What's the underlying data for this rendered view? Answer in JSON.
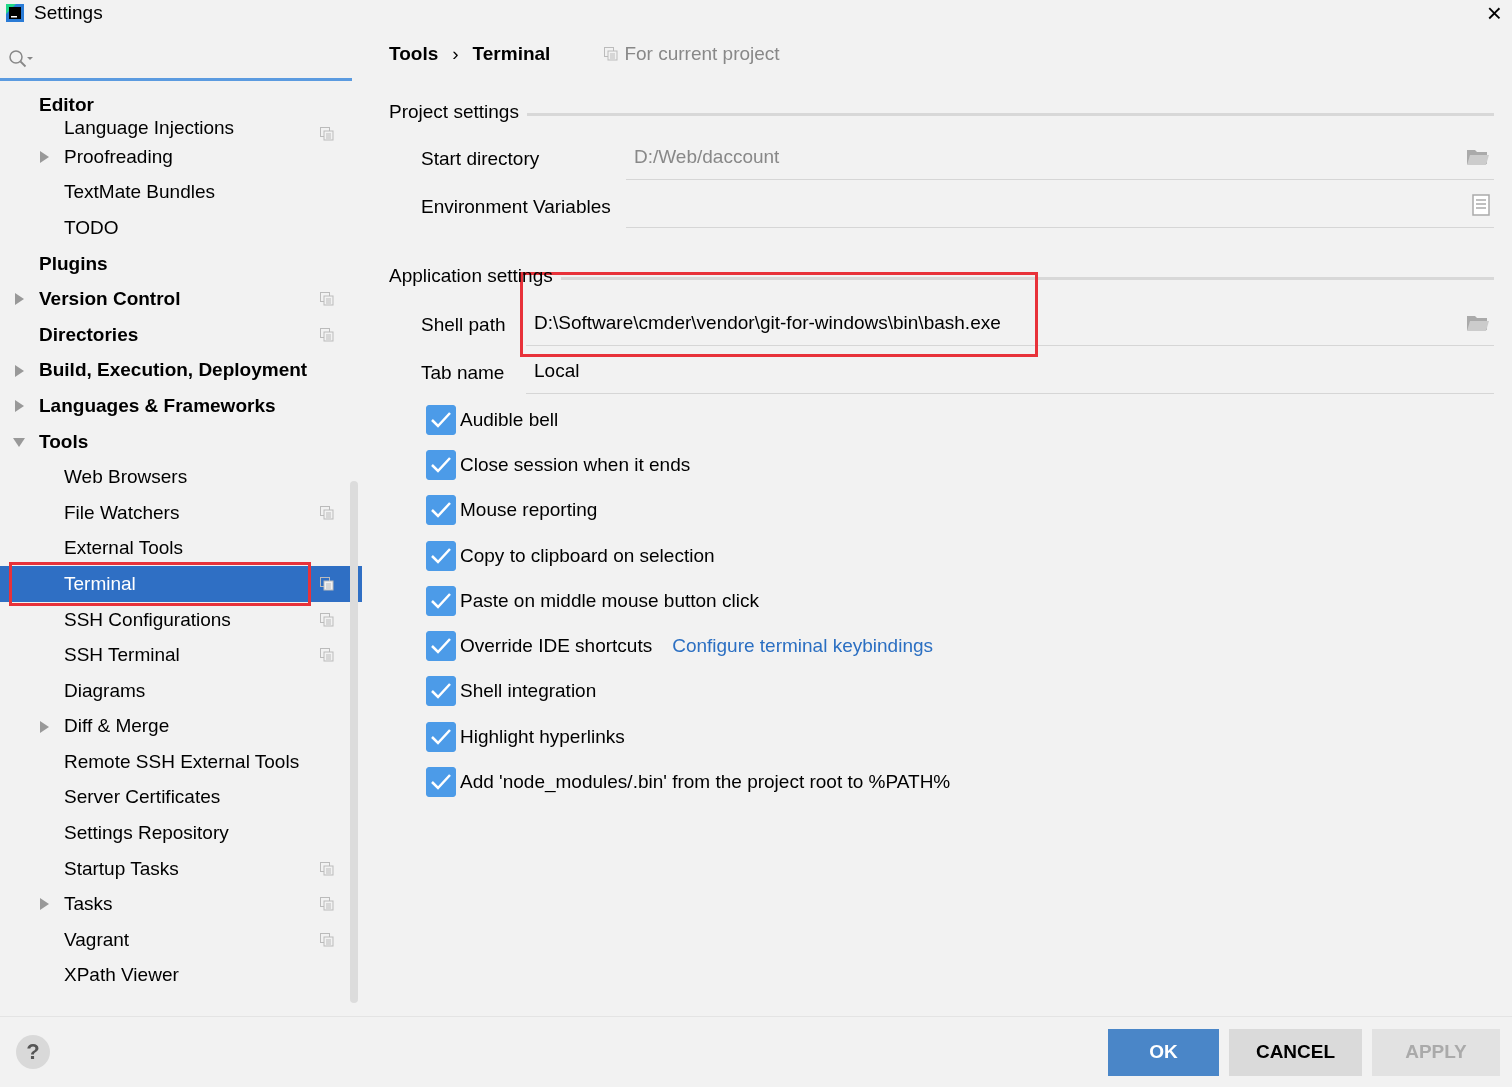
{
  "window": {
    "title": "Settings",
    "close": "×"
  },
  "sidebar": {
    "items": [
      {
        "label": "Editor",
        "bold": true,
        "scoped": false,
        "selected": false,
        "highlighted": false,
        "children": [
          {
            "label": "Language Injections",
            "bold": false,
            "scoped": true,
            "selected": false,
            "highlighted": false
          },
          {
            "label": "Proofreading",
            "bold": false,
            "expanded": false,
            "scoped": false,
            "selected": false,
            "highlighted": false
          },
          {
            "label": "TextMate Bundles",
            "bold": false,
            "scoped": false,
            "selected": false,
            "highlighted": false
          },
          {
            "label": "TODO",
            "bold": false,
            "scoped": false,
            "selected": false,
            "highlighted": false
          }
        ]
      },
      {
        "label": "Plugins",
        "bold": true,
        "scoped": false,
        "selected": false,
        "highlighted": false
      },
      {
        "label": "Version Control",
        "bold": true,
        "expanded": false,
        "scoped": true,
        "selected": false,
        "highlighted": false
      },
      {
        "label": "Directories",
        "bold": true,
        "scoped": true,
        "selected": false,
        "highlighted": false
      },
      {
        "label": "Build, Execution, Deployment",
        "bold": true,
        "expanded": false,
        "scoped": false,
        "selected": false,
        "highlighted": false
      },
      {
        "label": "Languages & Frameworks",
        "bold": true,
        "expanded": false,
        "scoped": false,
        "selected": false,
        "highlighted": false
      },
      {
        "label": "Tools",
        "bold": true,
        "expanded": true,
        "scoped": false,
        "selected": false,
        "highlighted": false,
        "children": [
          {
            "label": "Web Browsers",
            "bold": false,
            "scoped": false,
            "selected": false,
            "highlighted": false
          },
          {
            "label": "File Watchers",
            "bold": false,
            "scoped": true,
            "selected": false,
            "highlighted": false
          },
          {
            "label": "External Tools",
            "bold": false,
            "scoped": false,
            "selected": false,
            "highlighted": false
          },
          {
            "label": "Terminal",
            "bold": false,
            "scoped": true,
            "selected": true,
            "highlighted": true
          },
          {
            "label": "SSH Configurations",
            "bold": false,
            "scoped": true,
            "selected": false,
            "highlighted": false
          },
          {
            "label": "SSH Terminal",
            "bold": false,
            "scoped": true,
            "selected": false,
            "highlighted": false
          },
          {
            "label": "Diagrams",
            "bold": false,
            "scoped": false,
            "selected": false,
            "highlighted": false
          },
          {
            "label": "Diff & Merge",
            "bold": false,
            "expanded": false,
            "scoped": false,
            "selected": false,
            "highlighted": false
          },
          {
            "label": "Remote SSH External Tools",
            "bold": false,
            "scoped": false,
            "selected": false,
            "highlighted": false
          },
          {
            "label": "Server Certificates",
            "bold": false,
            "scoped": false,
            "selected": false,
            "highlighted": false
          },
          {
            "label": "Settings Repository",
            "bold": false,
            "scoped": false,
            "selected": false,
            "highlighted": false
          },
          {
            "label": "Startup Tasks",
            "bold": false,
            "scoped": true,
            "selected": false,
            "highlighted": false
          },
          {
            "label": "Tasks",
            "bold": false,
            "expanded": false,
            "scoped": true,
            "selected": false,
            "highlighted": false
          },
          {
            "label": "Vagrant",
            "bold": false,
            "scoped": true,
            "selected": false,
            "highlighted": false
          },
          {
            "label": "XPath Viewer",
            "bold": false,
            "scoped": false,
            "selected": false,
            "highlighted": false
          }
        ]
      }
    ]
  },
  "breadcrumb": {
    "items": [
      "Tools",
      "Terminal"
    ],
    "separator": "›",
    "scope": "For current project"
  },
  "project_settings": {
    "title": "Project settings",
    "fields": [
      {
        "label": "Start directory",
        "value": "D:/Web/daccount",
        "kind": "folder",
        "highlighted": false
      },
      {
        "label": "Environment Variables",
        "kind": "list",
        "highlighted": false
      }
    ]
  },
  "application_settings": {
    "title": "Application settings",
    "fields": [
      {
        "label": "Shell path",
        "value": "D:\\Software\\cmder\\vendor\\git-for-windows\\bin\\bash.exe",
        "kind": "folder",
        "highlighted": true
      },
      {
        "label": "Tab name",
        "value": "Local",
        "kind": "text",
        "highlighted": false
      }
    ],
    "checkboxes": [
      {
        "label": "Audible bell",
        "checked": true
      },
      {
        "label": "Close session when it ends",
        "checked": true
      },
      {
        "label": "Mouse reporting",
        "checked": true
      },
      {
        "label": "Copy to clipboard on selection",
        "checked": true
      },
      {
        "label": "Paste on middle mouse button click",
        "checked": true
      },
      {
        "label": "Override IDE shortcuts",
        "checked": true,
        "link": "Configure terminal keybindings"
      },
      {
        "label": "Shell integration",
        "checked": true
      },
      {
        "label": "Highlight hyperlinks",
        "checked": true
      },
      {
        "label": "Add 'node_modules/.bin' from the project root to %PATH%",
        "checked": true
      }
    ]
  },
  "footer": {
    "help": "?",
    "buttons": [
      {
        "label": "OK",
        "kind": "primary",
        "disabled": false
      },
      {
        "label": "CANCEL",
        "kind": "normal",
        "disabled": false
      },
      {
        "label": "APPLY",
        "kind": "normal",
        "disabled": true
      }
    ]
  }
}
